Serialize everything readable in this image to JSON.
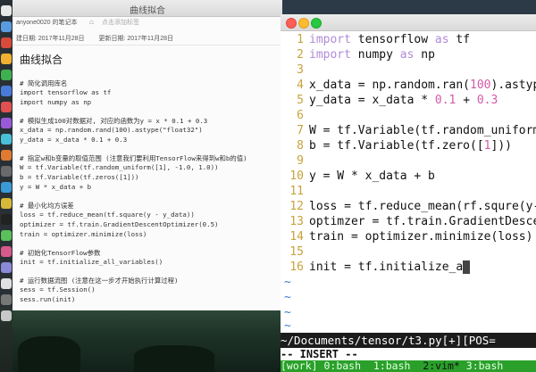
{
  "window": {
    "title": "曲线拟合"
  },
  "note": {
    "notebook": "anyone0020 的笔记本",
    "tag_hint": "点击添加标签",
    "created": "建日期: 2017年11月28日",
    "updated": "更新日期: 2017年11月28日",
    "title": "曲线拟合",
    "lines": [
      "# 简化调用库名",
      "import tensorflow as tf",
      "import numpy as np",
      "# 模拟生成100对数据对, 对应的函数为y = x * 0.1 + 0.3",
      "x_data = np.random.rand(100).astype(\"float32\")",
      "y_data = x_data * 0.1 + 0.3",
      "# 指定w和b变量的取值范围 (注意我们要利用TensorFlow来得到w和b的值)",
      "W = tf.Variable(tf.random_uniform([1], -1.0, 1.0))",
      "b = tf.Variable(tf.zeros([1]))",
      "y = W * x_data + b",
      "# 最小化均方误差",
      "loss = tf.reduce_mean(tf.square(y - y_data))",
      "optimizer = tf.train.GradientDescentOptimizer(0.5)",
      "train = optimizer.minimize(loss)",
      "# 初始化TensorFlow参数",
      "init = tf.initialize_all_variables()",
      "# 运行数据流图 (注意在这一步才开始执行计算过程)",
      "sess = tf.Session()",
      "sess.run(init)"
    ]
  },
  "terminal": {
    "lines": [
      {
        "num": "1",
        "text": "import tensorflow as tf"
      },
      {
        "num": "2",
        "text": "import numpy as np"
      },
      {
        "num": "3",
        "text": ""
      },
      {
        "num": "4",
        "text": "x_data = np.random.ran(100).astyp"
      },
      {
        "num": "5",
        "text": "y_data = x_data * 0.1 + 0.3"
      },
      {
        "num": "6",
        "text": ""
      },
      {
        "num": "7",
        "text": "W = tf.Variable(tf.random_uniform"
      },
      {
        "num": "8",
        "text": "b = tf.Variable(tf.zero([1]))"
      },
      {
        "num": "9",
        "text": ""
      },
      {
        "num": "10",
        "text": "y = W * x_data + b"
      },
      {
        "num": "11",
        "text": ""
      },
      {
        "num": "12",
        "text": "loss = tf.reduce_mean(rf.squre(y-"
      },
      {
        "num": "13",
        "text": "optimzer = tf.train.GradientDesce"
      },
      {
        "num": "14",
        "text": "train = optimizer.minimize(loss)"
      },
      {
        "num": "15",
        "text": ""
      },
      {
        "num": "16",
        "text": "init = tf.initialize_a"
      }
    ],
    "tilde": "~",
    "status": "~/Documents/tensor/t3.py[+][POS=",
    "mode": "-- INSERT --",
    "tmux": {
      "session": "[work]",
      "win0": "0:bash",
      "win1": "1:bash",
      "win2": "2:vim*",
      "win3": "3:bash"
    }
  },
  "colors": {
    "keyword": "#b08ad8",
    "number": "#d45aa8",
    "line_number": "#c7a23c",
    "tilde": "#3a7ad8",
    "tmux_bar": "#2aa02a",
    "comment": "#d05a3a"
  }
}
